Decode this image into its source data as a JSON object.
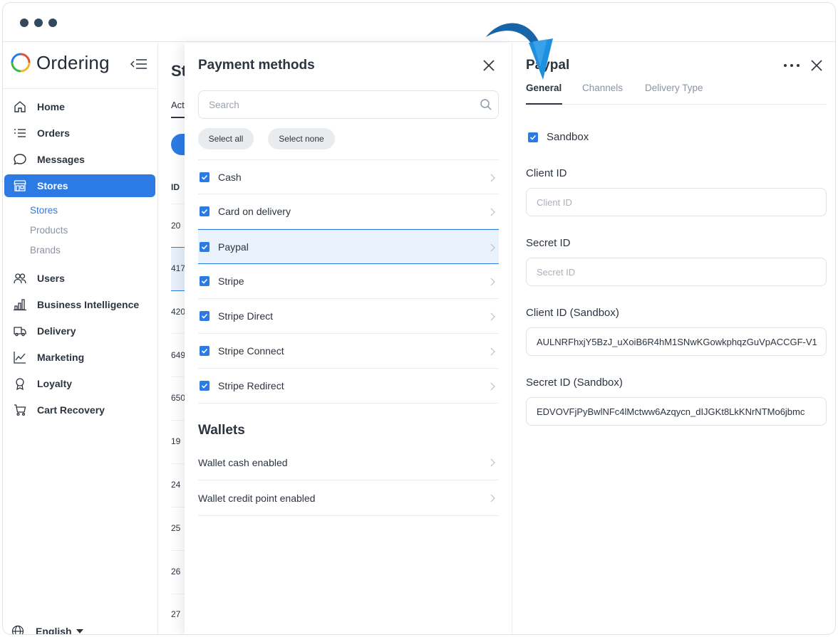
{
  "window": {
    "controls": [
      "dot",
      "dot",
      "dot"
    ]
  },
  "sidebar": {
    "brand": "Ordering",
    "items": [
      {
        "label": "Home",
        "icon": "home-icon"
      },
      {
        "label": "Orders",
        "icon": "list-icon"
      },
      {
        "label": "Messages",
        "icon": "chat-icon"
      },
      {
        "label": "Stores",
        "icon": "store-icon",
        "active": true
      },
      {
        "label": "Users",
        "icon": "users-icon"
      },
      {
        "label": "Business Intelligence",
        "icon": "bar-chart-icon"
      },
      {
        "label": "Delivery",
        "icon": "truck-icon"
      },
      {
        "label": "Marketing",
        "icon": "line-chart-icon"
      },
      {
        "label": "Loyalty",
        "icon": "award-icon"
      },
      {
        "label": "Cart Recovery",
        "icon": "cart-icon"
      }
    ],
    "sub_items": [
      {
        "label": "Stores",
        "active": true
      },
      {
        "label": "Products"
      },
      {
        "label": "Brands"
      }
    ],
    "language": "English"
  },
  "background_page": {
    "title": "St",
    "tab": "Act",
    "id_header": "ID",
    "ids": [
      "20",
      "417",
      "420",
      "649",
      "650",
      "19",
      "24",
      "25",
      "26",
      "27"
    ]
  },
  "payment_methods": {
    "title": "Payment methods",
    "search_placeholder": "Search",
    "select_all": "Select all",
    "select_none": "Select none",
    "methods": [
      {
        "label": "Cash",
        "checked": true
      },
      {
        "label": "Card on delivery",
        "checked": true
      },
      {
        "label": "Paypal",
        "checked": true,
        "selected": true
      },
      {
        "label": "Stripe",
        "checked": true
      },
      {
        "label": "Stripe Direct",
        "checked": true
      },
      {
        "label": "Stripe Connect",
        "checked": true
      },
      {
        "label": "Stripe Redirect",
        "checked": true
      }
    ],
    "wallets_title": "Wallets",
    "wallets": [
      {
        "label": "Wallet cash enabled"
      },
      {
        "label": "Wallet credit point enabled"
      }
    ]
  },
  "paypal": {
    "title": "Paypal",
    "tabs": [
      {
        "label": "General",
        "active": true
      },
      {
        "label": "Channels"
      },
      {
        "label": "Delivery Type"
      }
    ],
    "sandbox_label": "Sandbox",
    "sandbox_checked": true,
    "fields": [
      {
        "label": "Client ID",
        "placeholder": "Client ID",
        "value": ""
      },
      {
        "label": "Secret ID",
        "placeholder": "Secret ID",
        "value": ""
      },
      {
        "label": "Client ID (Sandbox)",
        "placeholder": "",
        "value": "AULNRFhxjY5BzJ_uXoiB6R4hM1SNwKGowkphqzGuVpACCGF-V1"
      },
      {
        "label": "Secret ID (Sandbox)",
        "placeholder": "",
        "value": "EDVOVFjPyBwlNFc4lMctww6Azqycn_dIJGKt8LkKNrNTMo6jbmc"
      }
    ]
  },
  "colors": {
    "accent": "#2c7be5",
    "arrow": "#1565a8",
    "text": "#2c3440"
  }
}
